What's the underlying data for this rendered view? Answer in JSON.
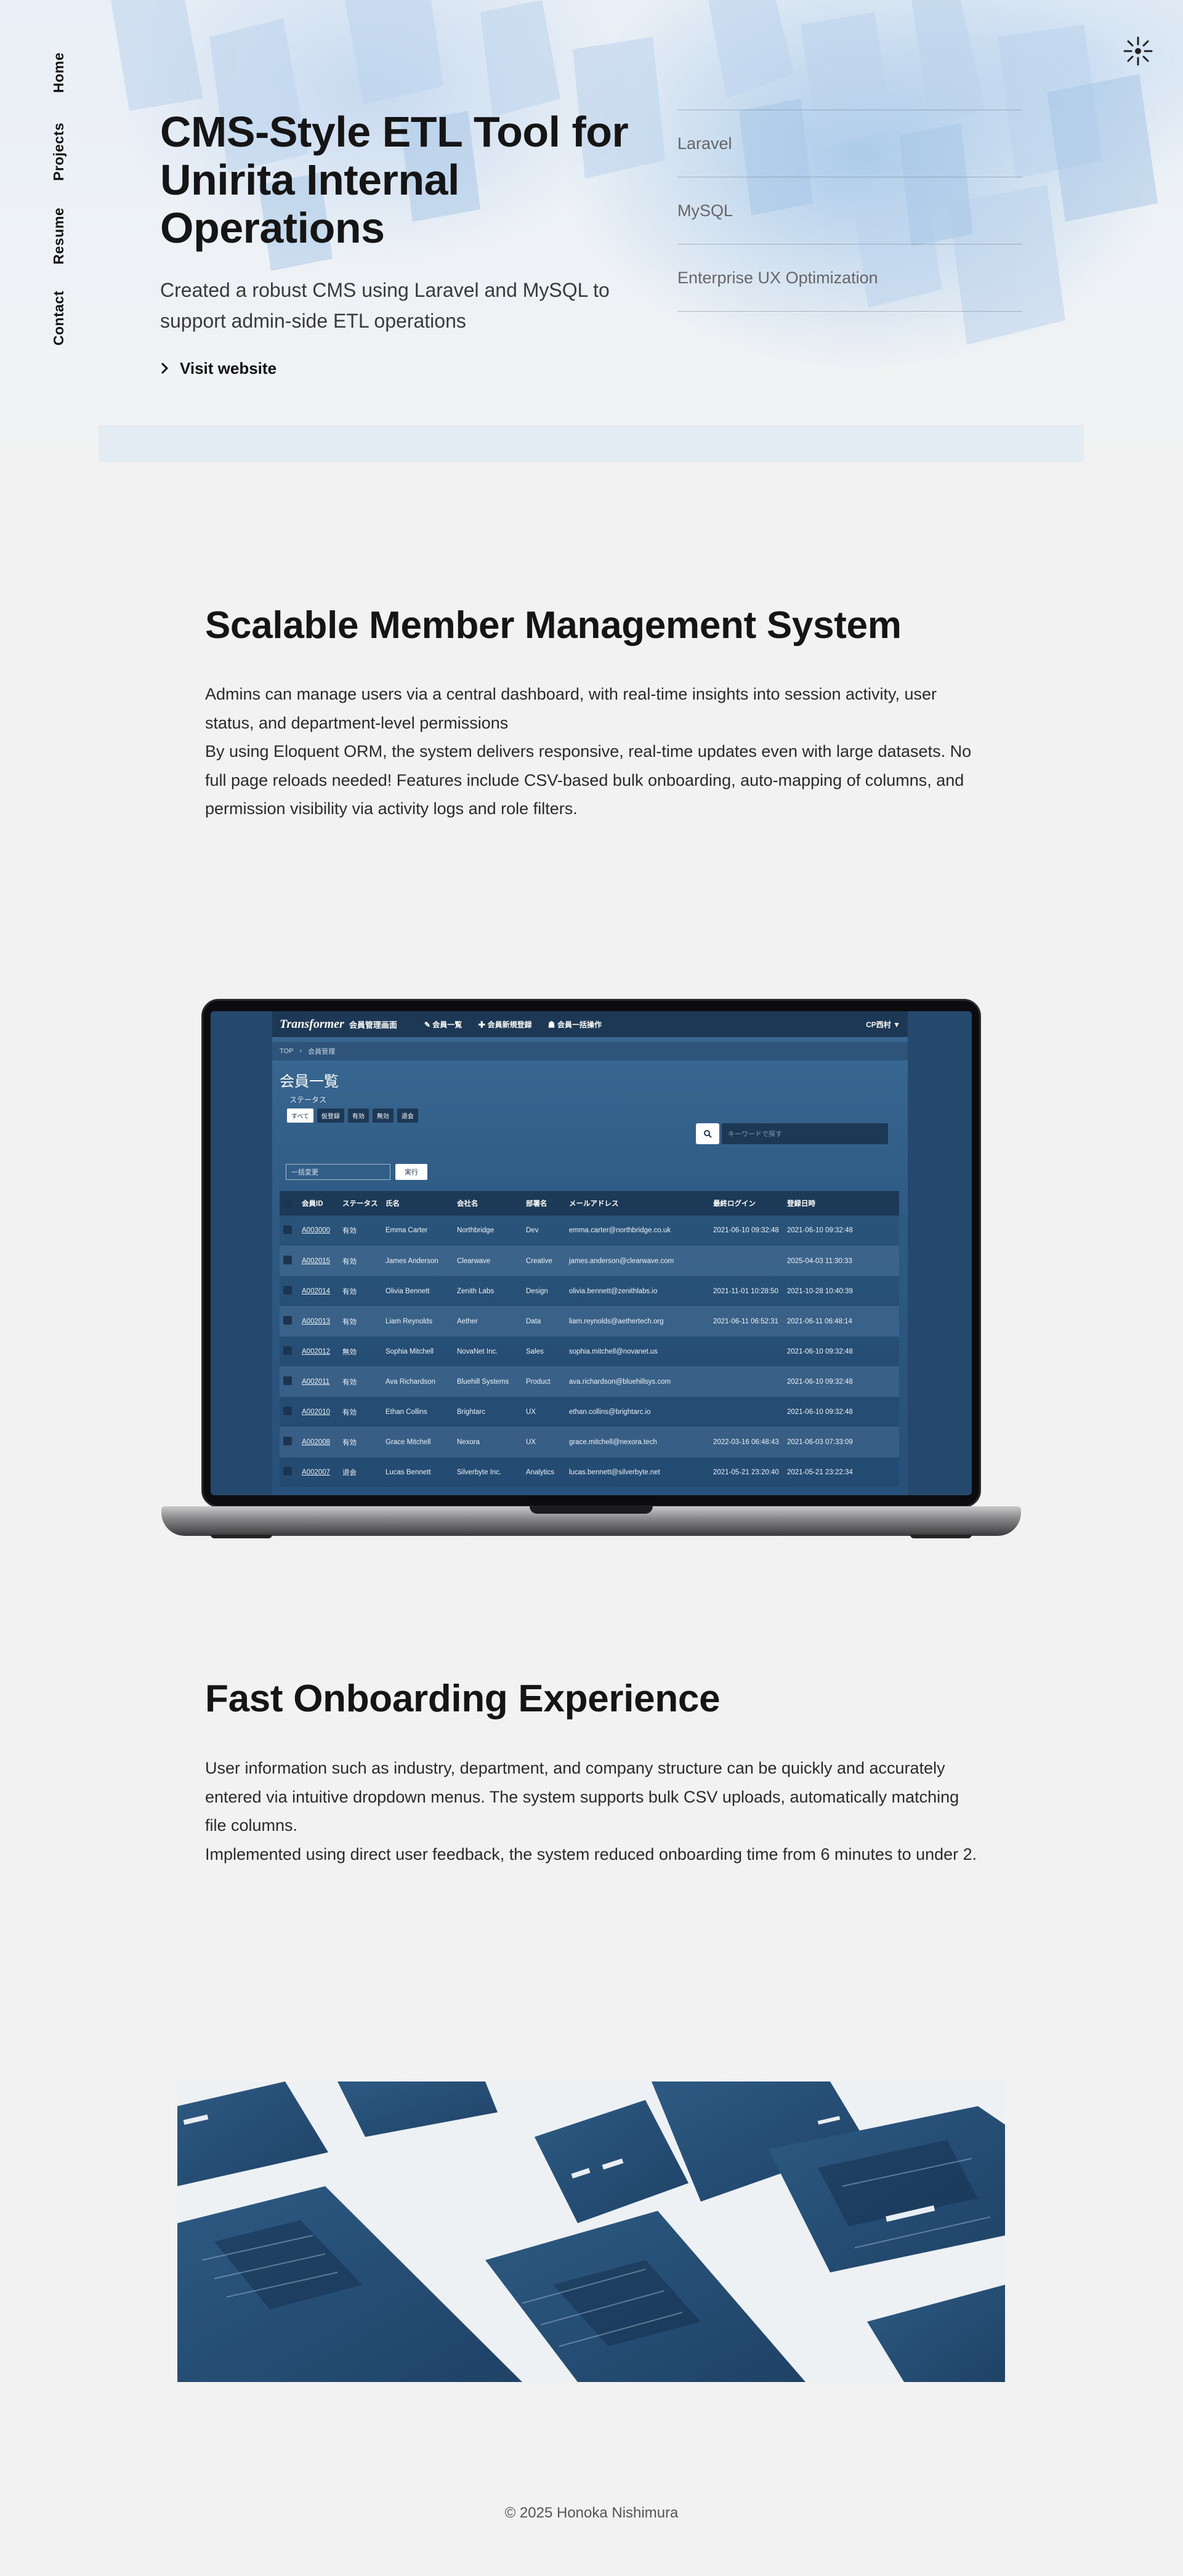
{
  "side_nav": [
    "Home",
    "Projects",
    "Resume",
    "Contact"
  ],
  "hero": {
    "title": "CMS-Style ETL Tool for Unirita Internal Operations",
    "subtitle": "Created a robust CMS using Laravel and MySQL to support admin-side ETL operations",
    "link_label": "Visit website",
    "tech": [
      "Laravel",
      "MySQL",
      "Enterprise UX Optimization"
    ]
  },
  "section1": {
    "title": "Scalable Member Management System",
    "paragraphs": [
      "Admins can manage users via a central dashboard, with real-time insights into session activity, user status, and department-level permissions",
      "By using Eloquent ORM, the system delivers responsive, real-time updates even with large datasets. No full page reloads needed! Features include CSV-based bulk onboarding, auto-mapping of columns, and permission visibility via activity logs and role filters."
    ]
  },
  "app": {
    "logo": "Transformer",
    "system_name": "会員管理画面",
    "nav": [
      "会員一覧",
      "会員新規登録",
      "会員一括操作"
    ],
    "user": "CP西村 ▼",
    "breadcrumb": [
      "TOP",
      "会員管理"
    ],
    "page_heading": "会員一覧",
    "status_label": "ステータス",
    "filters": [
      "すべて",
      "仮登録",
      "有効",
      "無効",
      "退会"
    ],
    "search_placeholder": "キーワードで探す",
    "bulk_select": "一括変更",
    "run_button": "実行",
    "columns": [
      "会員ID",
      "ステータス",
      "氏名",
      "会社名",
      "部署名",
      "メールアドレス",
      "最終ログイン",
      "登録日時"
    ],
    "rows": [
      [
        "A003000",
        "有効",
        "Emma Carter",
        "Northbridge",
        "Dev",
        "emma.carter@northbridge.co.uk",
        "2021-06-10 09:32:48",
        "2021-06-10 09:32:48"
      ],
      [
        "A002015",
        "有効",
        "James Anderson",
        "Clearwave",
        "Creative",
        "james.anderson@clearwave.com",
        "",
        "2025-04-03 11:30:33"
      ],
      [
        "A002014",
        "有効",
        "Olivia Bennett",
        "Zenith Labs",
        "Design",
        "olivia.bennett@zenithlabs.io",
        "2021-11-01 10:28:50",
        "2021-10-28 10:40:39"
      ],
      [
        "A002013",
        "有効",
        "Liam Reynolds",
        "Aether",
        "Data",
        "liam.reynolds@aethertech.org",
        "2021-06-11 06:52:31",
        "2021-06-11 06:48:14"
      ],
      [
        "A002012",
        "無効",
        "Sophia Mitchell",
        "NovaNet Inc.",
        "Sales",
        "sophia.mitchell@novanet.us",
        "",
        "2021-06-10 09:32:48"
      ],
      [
        "A002011",
        "有効",
        "Ava Richardson",
        "Bluehill Systems",
        "Product",
        "ava.richardson@bluehillsys.com",
        "",
        "2021-06-10 09:32:48"
      ],
      [
        "A002010",
        "有効",
        "Ethan Collins",
        "Brightarc",
        "UX",
        "ethan.collins@brightarc.io",
        "",
        "2021-06-10 09:32:48"
      ],
      [
        "A002008",
        "有効",
        "Grace Mitchell",
        "Nexora",
        "UX",
        "grace.mitchell@nexora.tech",
        "2022-03-16 06:48:43",
        "2021-06-03 07:33:09"
      ],
      [
        "A002007",
        "退会",
        "Lucas Bennett",
        "Silverbyte Inc.",
        "Analytics",
        "lucas.bennett@silverbyte.net",
        "2021-05-21 23:20:40",
        "2021-05-21 23:22:34"
      ]
    ]
  },
  "section2": {
    "title": "Fast Onboarding Experience",
    "paragraphs": [
      "User information such as industry, department, and company structure can be quickly and accurately entered via intuitive dropdown menus. The system supports bulk CSV uploads, automatically matching file columns.",
      "Implemented using direct user feedback, the system reduced onboarding time from 6 minutes to under 2."
    ]
  },
  "footer": {
    "copyright": "© 2025 Honoka Nishimura"
  },
  "colors": {
    "accent_blue": "#2f5b84",
    "dark_navy": "#1d3855",
    "background": "#f2f2f2"
  }
}
